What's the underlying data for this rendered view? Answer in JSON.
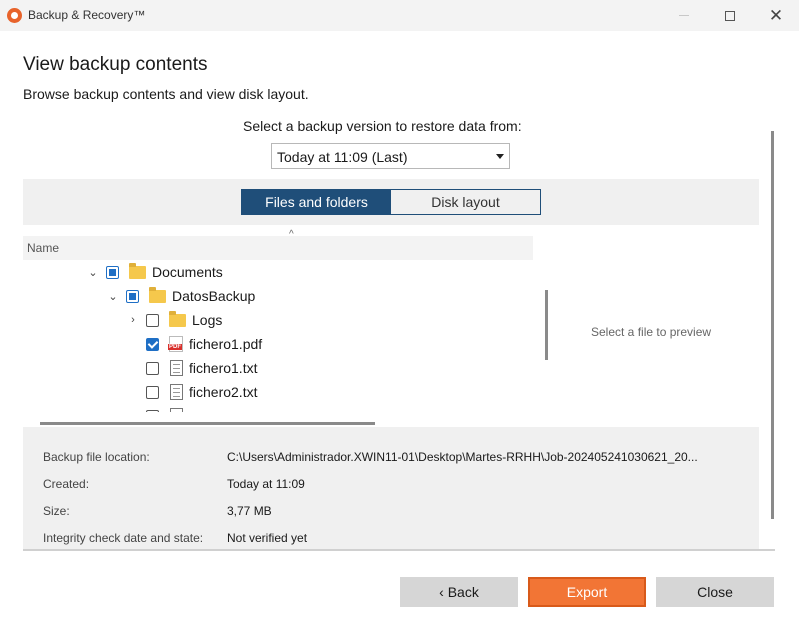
{
  "window": {
    "title": "Backup & Recovery™"
  },
  "page": {
    "heading": "View backup contents",
    "subheading": "Browse backup contents and view disk layout."
  },
  "version": {
    "label": "Select a backup version to restore data from:",
    "selected": "Today at 11:09 (Last)"
  },
  "view_toggle": {
    "files": "Files and folders",
    "disk": "Disk layout",
    "active": "files"
  },
  "tree": {
    "column_header": "Name",
    "items": [
      {
        "label": "Documents",
        "icon": "folder-icon",
        "state": "partial",
        "expander": "expanded"
      },
      {
        "label": "DatosBackup",
        "icon": "folder-icon",
        "state": "partial",
        "expander": "expanded"
      },
      {
        "label": "Logs",
        "icon": "folder-icon",
        "state": "unchecked",
        "expander": "collapsed"
      },
      {
        "label": "fichero1.pdf",
        "icon": "pdf-file-icon",
        "state": "checked",
        "expander": "none"
      },
      {
        "label": "fichero1.txt",
        "icon": "text-file-icon",
        "state": "unchecked",
        "expander": "none"
      },
      {
        "label": "fichero2.txt",
        "icon": "text-file-icon",
        "state": "unchecked",
        "expander": "none"
      }
    ]
  },
  "preview": {
    "placeholder": "Select a file to preview"
  },
  "info": {
    "location_label": "Backup file location:",
    "location_value": "C:\\Users\\Administrador.XWIN11-01\\Desktop\\Martes-RRHH\\Job-20240524103062​1_20...",
    "created_label": "Created:",
    "created_value": "Today at 11:09",
    "size_label": "Size:",
    "size_value": "3,77 MB",
    "integrity_label": "Integrity check date and state:",
    "integrity_value": "Not verified yet"
  },
  "buttons": {
    "back": "‹ Back",
    "export": "Export",
    "close": "Close"
  },
  "colors": {
    "accent": "#1f4e79",
    "export": "#f27535",
    "checkbox": "#1f6fc5"
  }
}
